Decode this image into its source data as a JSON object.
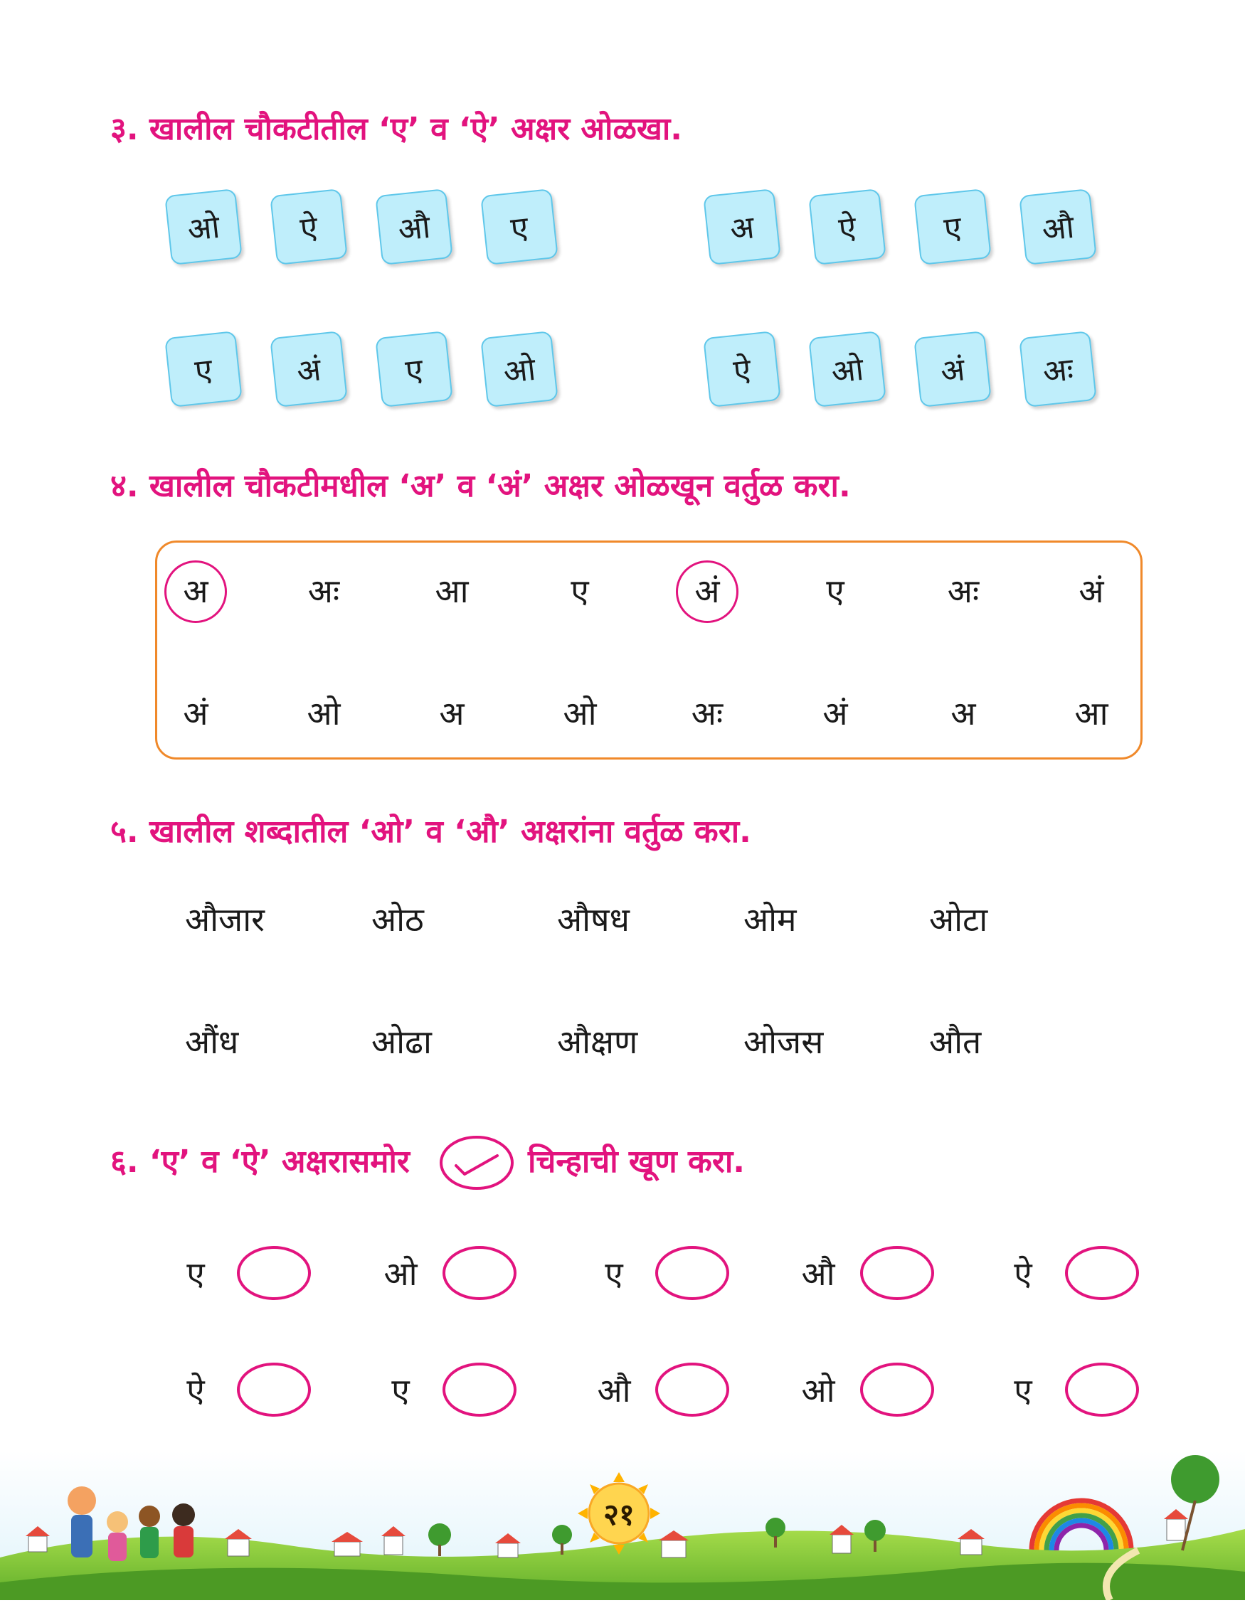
{
  "q3": {
    "heading": "३. खालील चौकटीतील ‘ए’ व ‘ऐ’ अक्षर ओळखा.",
    "row1_left": [
      "ओ",
      "ऐ",
      "औ",
      "ए"
    ],
    "row1_right": [
      "अ",
      "ऐ",
      "ए",
      "औ"
    ],
    "row2_left": [
      "ए",
      "अं",
      "ए",
      "ओ"
    ],
    "row2_right": [
      "ऐ",
      "ओ",
      "अं",
      "अः"
    ]
  },
  "q4": {
    "heading": "४. खालील चौकटीमधील ‘अ’ व ‘अं’ अक्षर ओळखून वर्तुळ करा.",
    "row1": [
      "अ",
      "अः",
      "आ",
      "ए",
      "अं",
      "ए",
      "अः",
      "अं"
    ],
    "row2": [
      "अं",
      "ओ",
      "अ",
      "ओ",
      "अः",
      "अं",
      "अ",
      "आ"
    ]
  },
  "q5": {
    "heading": "५. खालील शब्दातील ‘ओ’ व ‘औ’ अक्षरांना वर्तुळ करा.",
    "row1": [
      "औजार",
      "ओठ",
      "औषध",
      "ओम",
      "ओटा"
    ],
    "row2": [
      "औंध",
      "ओढा",
      "औक्षण",
      "ओजस",
      "औत"
    ]
  },
  "q6": {
    "heading_part1": "६. ‘ए’ व ‘ऐ’ अक्षरासमोर",
    "heading_part2": "चिन्हाची खूण करा.",
    "row1": [
      "ए",
      "ओ",
      "ए",
      "औ",
      "ऐ"
    ],
    "row2": [
      "ऐ",
      "ए",
      "औ",
      "ओ",
      "ए"
    ]
  },
  "page_number": "२१",
  "colors": {
    "heading": "#e2137e",
    "tile_fill": "#bfeefb",
    "tile_border": "#5fc7ea",
    "box_border": "#f0892a"
  }
}
